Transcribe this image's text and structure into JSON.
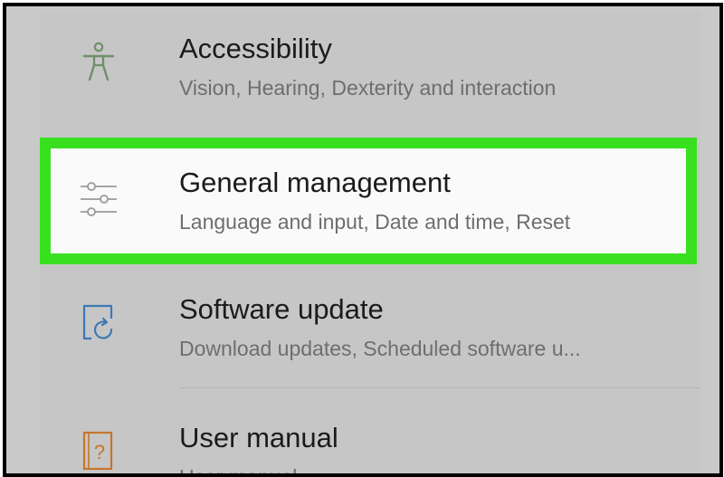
{
  "settings": {
    "items": [
      {
        "title": "Accessibility",
        "subtitle": "Vision, Hearing, Dexterity and interaction",
        "icon": "accessibility-person-icon",
        "icon_color": "#6f8f6a"
      },
      {
        "title": "General management",
        "subtitle": "Language and input, Date and time, Reset",
        "icon": "sliders-icon",
        "icon_color": "#9a9a9a",
        "highlighted": true
      },
      {
        "title": "Software update",
        "subtitle": "Download updates, Scheduled software u...",
        "icon": "software-update-icon",
        "icon_color": "#3d78b5"
      },
      {
        "title": "User manual",
        "subtitle": "User manual",
        "icon": "help-book-icon",
        "icon_color": "#c8752c"
      }
    ]
  },
  "colors": {
    "highlight_border": "#39e01f",
    "background": "#c6c6c6"
  }
}
